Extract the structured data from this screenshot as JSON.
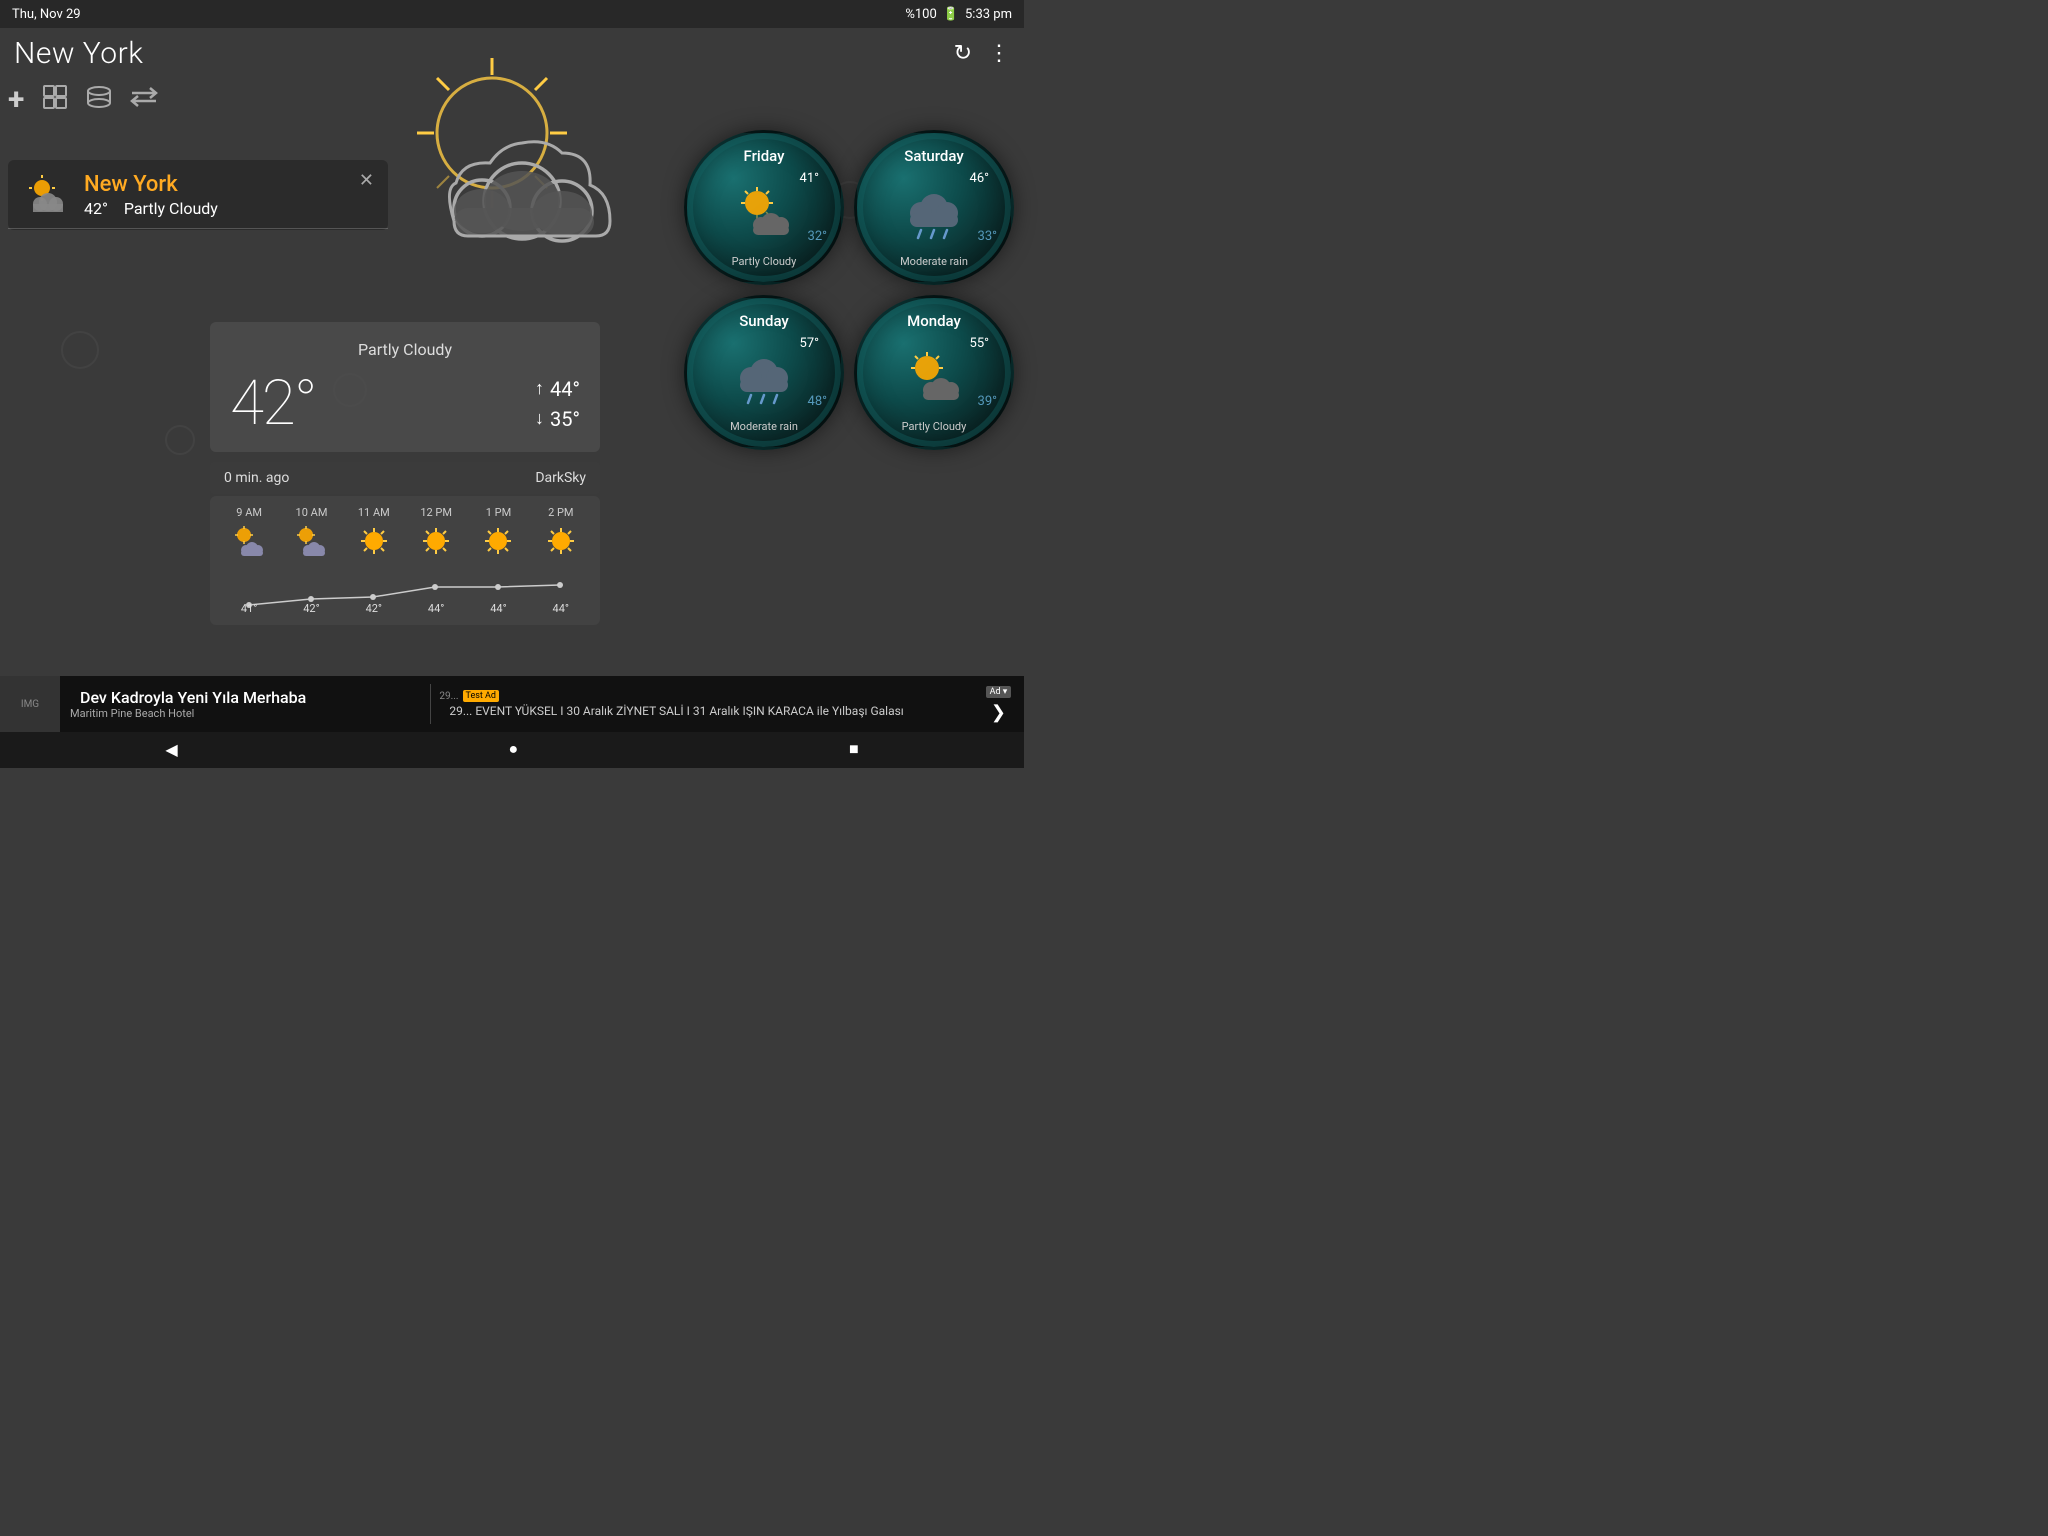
{
  "statusBar": {
    "date": "Thu, Nov 29",
    "battery": "%100",
    "time": "5:33 pm"
  },
  "header": {
    "cityName": "New York",
    "refreshLabel": "↻",
    "menuLabel": "⋮"
  },
  "toolbar": {
    "addIcon": "+",
    "gridIcon": "⊞",
    "listIcon": "☰",
    "swapIcon": "⇄"
  },
  "locationCard": {
    "city": "New York",
    "temp": "42°",
    "condition": "Partly Cloudy",
    "closeLabel": "✕"
  },
  "weatherDetail": {
    "condition": "Partly Cloudy",
    "temp": "42°",
    "hiLabel": "44°",
    "loLabel": "35°",
    "updateTime": "0 min. ago",
    "source": "DarkSky"
  },
  "hourly": {
    "hours": [
      "9 AM",
      "10 AM",
      "11 AM",
      "12 PM",
      "1 PM",
      "2 PM"
    ],
    "icons": [
      "sun-cloud",
      "sun-cloud",
      "sun",
      "sun",
      "sun",
      "sun"
    ],
    "temps": [
      "41°",
      "42°",
      "42°",
      "44°",
      "44°",
      "44°"
    ]
  },
  "forecast": [
    {
      "day": "Friday",
      "hi": "41°",
      "lo": "32°",
      "condition": "Partly Cloudy",
      "iconType": "sun-cloud"
    },
    {
      "day": "Saturday",
      "hi": "46°",
      "lo": "33°",
      "condition": "Moderate rain",
      "iconType": "cloud-rain"
    },
    {
      "day": "Sunday",
      "hi": "57°",
      "lo": "48°",
      "condition": "Moderate rain",
      "iconType": "rain-cloud"
    },
    {
      "day": "Monday",
      "hi": "55°",
      "lo": "39°",
      "condition": "Partly Cloudy",
      "iconType": "sun-cloud"
    }
  ],
  "navDots": {
    "active": 0,
    "total": 3
  },
  "adBanner": {
    "mainText": "Dev Kadroyla Yeni Yıla Merhaba",
    "subText": "Maritim Pine Beach Hotel",
    "rightText": "29... EVENT YÜKSEL I 30 Aralık ZİYNET SALİ I 31 Aralık IŞIN KARACA ile Yılbaşı Galası",
    "adLabel": "Ad ▾",
    "chevron": "❯",
    "testAdLabel": "Test Ad"
  },
  "sysNav": {
    "back": "◀",
    "home": "●",
    "recent": "■"
  }
}
